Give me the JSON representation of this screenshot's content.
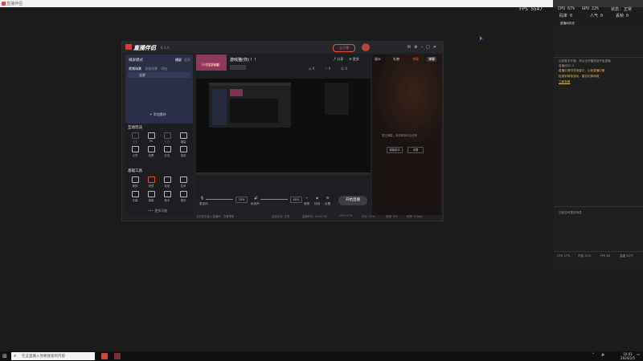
{
  "app": {
    "title": "直播伴侣"
  },
  "stats": {
    "fps": "FPS 5547",
    "cpu": "CPU 67%",
    "gpu": "GPU 22%",
    "right_top": "状态: 正常",
    "row2a": "码率 0",
    "row2b": "人气 0",
    "row2c": "丢帧 0"
  },
  "window": {
    "logo": "直播伴侣",
    "version": "8.3.4",
    "live_btn": "去开播",
    "mode_label": "横屏模式",
    "mode_tabs": [
      "横屏",
      "竖屏"
    ],
    "scene_tabs": [
      "视频场景",
      "游戏场景",
      "添加"
    ],
    "scene_item": "全屏",
    "add_material": "+ 添加素材",
    "interact_title": "互动玩法",
    "interact_items": [
      "连麦",
      "PK",
      "礼物",
      "福袋",
      "点赞",
      "投票",
      "红包",
      "抽奖"
    ],
    "tools_title": "基础工具",
    "tools_items": [
      "美颜",
      "滤镜",
      "贴纸",
      "变声",
      "字幕",
      "弹幕",
      "助手",
      "更多"
    ],
    "more_tools": "••• 更多功能",
    "room_title": "游戏猫(你) ！！",
    "cover_text": "一下文字标题",
    "controls": [
      "麦克风",
      "系统声",
      "美颜",
      "特效",
      "设置"
    ],
    "mic_pct": "70%",
    "sys_pct": "40%",
    "start_btn": "开始直播",
    "status_items": [
      "连接状态: 正常",
      "直播时长: 00:00:00",
      "CPU: 67%",
      "内存: 52%",
      "丢帧: 0%",
      "码率: 0 kb/s"
    ],
    "footer_tip": "当前暂未接入直播间 · 查看帮助"
  },
  "chat": {
    "tabs": [
      "观众",
      "礼物",
      "弹幕"
    ],
    "active_tab": "弹幕",
    "empty_text": "暂无弹幕，快去和观众互动吧",
    "btn1": "弹幕助手",
    "btn2": "设置"
  },
  "right_panel": {
    "title": "直播间状态",
    "line1": "当前暂未开播，请点击开播按钮开始直播",
    "line2": "直播间ID: 0",
    "warn1": "直播中请勿关闭窗口，以免直播中断",
    "warn2": "检测到网络波动，建议切换网络",
    "link": "立即查看",
    "line3": "当前没有更多消息",
    "bottom": [
      "CPU 17%",
      "内存 52%",
      "FPS 60",
      "温度 42℃"
    ]
  },
  "taskbar": {
    "search_placeholder": "在这里输入你要搜索的内容",
    "time": "10:01",
    "date": "2024/2/5"
  }
}
